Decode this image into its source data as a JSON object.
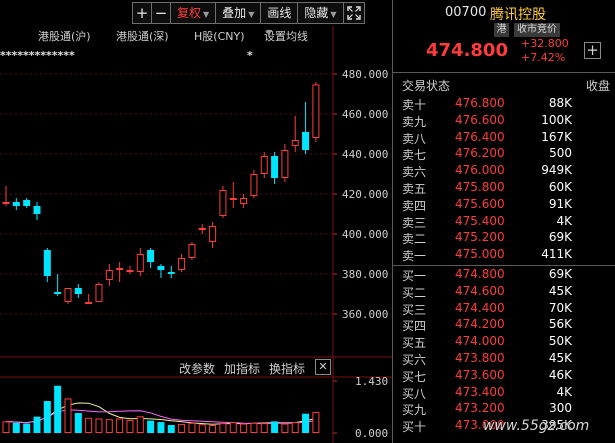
{
  "toolbar": {
    "plus": "+",
    "minus": "−",
    "adjust": "复权",
    "overlay": "叠加",
    "draw": "画线",
    "hide": "隐藏"
  },
  "menus": {
    "sh_connect": "港股通(沪)",
    "sz_connect": "港股通(深)",
    "h_share": "H股(CNY)",
    "ma_settings": "设置均线"
  },
  "stars": "*************",
  "star2": "*",
  "indicator_bar": {
    "change_params": "改参数",
    "add_indicator": "加指标",
    "switch_indicator": "换指标",
    "close": "✕"
  },
  "quote": {
    "code": "00700",
    "name": "腾讯控股",
    "market_badge": "港",
    "status_badge": "收市竞价",
    "price": "474.800",
    "change": "+32.800",
    "change_pct": "+7.42%",
    "add_button": "+",
    "trade_status_label": "交易状态",
    "trade_status_value": "收盘"
  },
  "order_book": {
    "asks": [
      {
        "label": "卖十",
        "price": "476.800",
        "volume": "88K"
      },
      {
        "label": "卖九",
        "price": "476.600",
        "volume": "100K"
      },
      {
        "label": "卖八",
        "price": "476.400",
        "volume": "167K"
      },
      {
        "label": "卖七",
        "price": "476.200",
        "volume": "500"
      },
      {
        "label": "卖六",
        "price": "476.000",
        "volume": "949K"
      },
      {
        "label": "卖五",
        "price": "475.800",
        "volume": "60K"
      },
      {
        "label": "卖四",
        "price": "475.600",
        "volume": "91K"
      },
      {
        "label": "卖三",
        "price": "475.400",
        "volume": "4K"
      },
      {
        "label": "卖二",
        "price": "475.200",
        "volume": "69K"
      },
      {
        "label": "卖一",
        "price": "475.000",
        "volume": "411K"
      }
    ],
    "bids": [
      {
        "label": "买一",
        "price": "474.800",
        "volume": "69K"
      },
      {
        "label": "买二",
        "price": "474.600",
        "volume": "45K"
      },
      {
        "label": "买三",
        "price": "474.400",
        "volume": "70K"
      },
      {
        "label": "买四",
        "price": "474.200",
        "volume": "56K"
      },
      {
        "label": "买五",
        "price": "474.000",
        "volume": "50K"
      },
      {
        "label": "买六",
        "price": "473.800",
        "volume": "45K"
      },
      {
        "label": "买七",
        "price": "473.600",
        "volume": "46K"
      },
      {
        "label": "买八",
        "price": "473.400",
        "volume": "4K"
      },
      {
        "label": "买九",
        "price": "473.200",
        "volume": "300"
      },
      {
        "label": "买十",
        "price": "473.000",
        "volume": "395K"
      }
    ]
  },
  "watermark": "www.55gz.com",
  "colors": {
    "up": "#ff3c3c",
    "down": "#00e5ff",
    "stock_name": "#ffcc33",
    "ma_line_1": "#f2f2a0",
    "ma_line_2": "#ff66ff"
  },
  "chart_data": {
    "type": "candlestick",
    "y_ticks": [
      "480.000",
      "460.000",
      "440.000",
      "420.000",
      "400.000",
      "380.000",
      "360.000"
    ],
    "ylim": [
      353,
      484
    ],
    "volume_ticks": [
      "1.430",
      "0.000"
    ],
    "volume_ylim": [
      0,
      1.43
    ],
    "candles": [
      {
        "open": 415.5,
        "high": 424,
        "low": 414,
        "close": 416
      },
      {
        "open": 416,
        "high": 418,
        "low": 412,
        "close": 414
      },
      {
        "open": 417,
        "high": 418,
        "low": 413,
        "close": 414
      },
      {
        "open": 414,
        "high": 416,
        "low": 407,
        "close": 410
      },
      {
        "open": 392,
        "high": 393,
        "low": 376,
        "close": 379
      },
      {
        "open": 371,
        "high": 380,
        "low": 369,
        "close": 370
      },
      {
        "open": 366,
        "high": 373,
        "low": 365,
        "close": 373
      },
      {
        "open": 373,
        "high": 375,
        "low": 368,
        "close": 370
      },
      {
        "open": 366,
        "high": 370,
        "low": 365,
        "close": 366
      },
      {
        "open": 366,
        "high": 376,
        "low": 366,
        "close": 375
      },
      {
        "open": 377,
        "high": 385,
        "low": 374,
        "close": 382
      },
      {
        "open": 382,
        "high": 386,
        "low": 376,
        "close": 383
      },
      {
        "open": 382,
        "high": 384,
        "low": 380,
        "close": 382
      },
      {
        "open": 381,
        "high": 393,
        "low": 379,
        "close": 390
      },
      {
        "open": 392,
        "high": 393,
        "low": 383,
        "close": 386
      },
      {
        "open": 384,
        "high": 385,
        "low": 378,
        "close": 382
      },
      {
        "open": 381,
        "high": 384,
        "low": 378,
        "close": 380
      },
      {
        "open": 382,
        "high": 390,
        "low": 381,
        "close": 388
      },
      {
        "open": 388,
        "high": 396,
        "low": 387,
        "close": 395
      },
      {
        "open": 402,
        "high": 405,
        "low": 400,
        "close": 403
      },
      {
        "open": 396,
        "high": 406,
        "low": 393,
        "close": 404
      },
      {
        "open": 409,
        "high": 424,
        "low": 408,
        "close": 422
      },
      {
        "open": 418,
        "high": 426,
        "low": 413,
        "close": 418
      },
      {
        "open": 415,
        "high": 420,
        "low": 413,
        "close": 418
      },
      {
        "open": 419,
        "high": 432,
        "low": 418,
        "close": 430
      },
      {
        "open": 430,
        "high": 441,
        "low": 428,
        "close": 439
      },
      {
        "open": 439,
        "high": 441,
        "low": 425,
        "close": 428
      },
      {
        "open": 428,
        "high": 445,
        "low": 426,
        "close": 442
      },
      {
        "open": 444,
        "high": 459,
        "low": 441,
        "close": 447
      },
      {
        "open": 451,
        "high": 466,
        "low": 440,
        "close": 442
      },
      {
        "open": 448,
        "high": 476,
        "low": 446,
        "close": 474.8
      }
    ],
    "volumes": [
      0.32,
      0.28,
      0.26,
      0.45,
      0.88,
      1.3,
      0.95,
      0.55,
      0.42,
      0.4,
      0.38,
      0.4,
      0.36,
      0.46,
      0.34,
      0.3,
      0.22,
      0.25,
      0.28,
      0.24,
      0.22,
      0.27,
      0.3,
      0.26,
      0.28,
      0.27,
      0.32,
      0.26,
      0.3,
      0.53,
      0.58
    ]
  }
}
